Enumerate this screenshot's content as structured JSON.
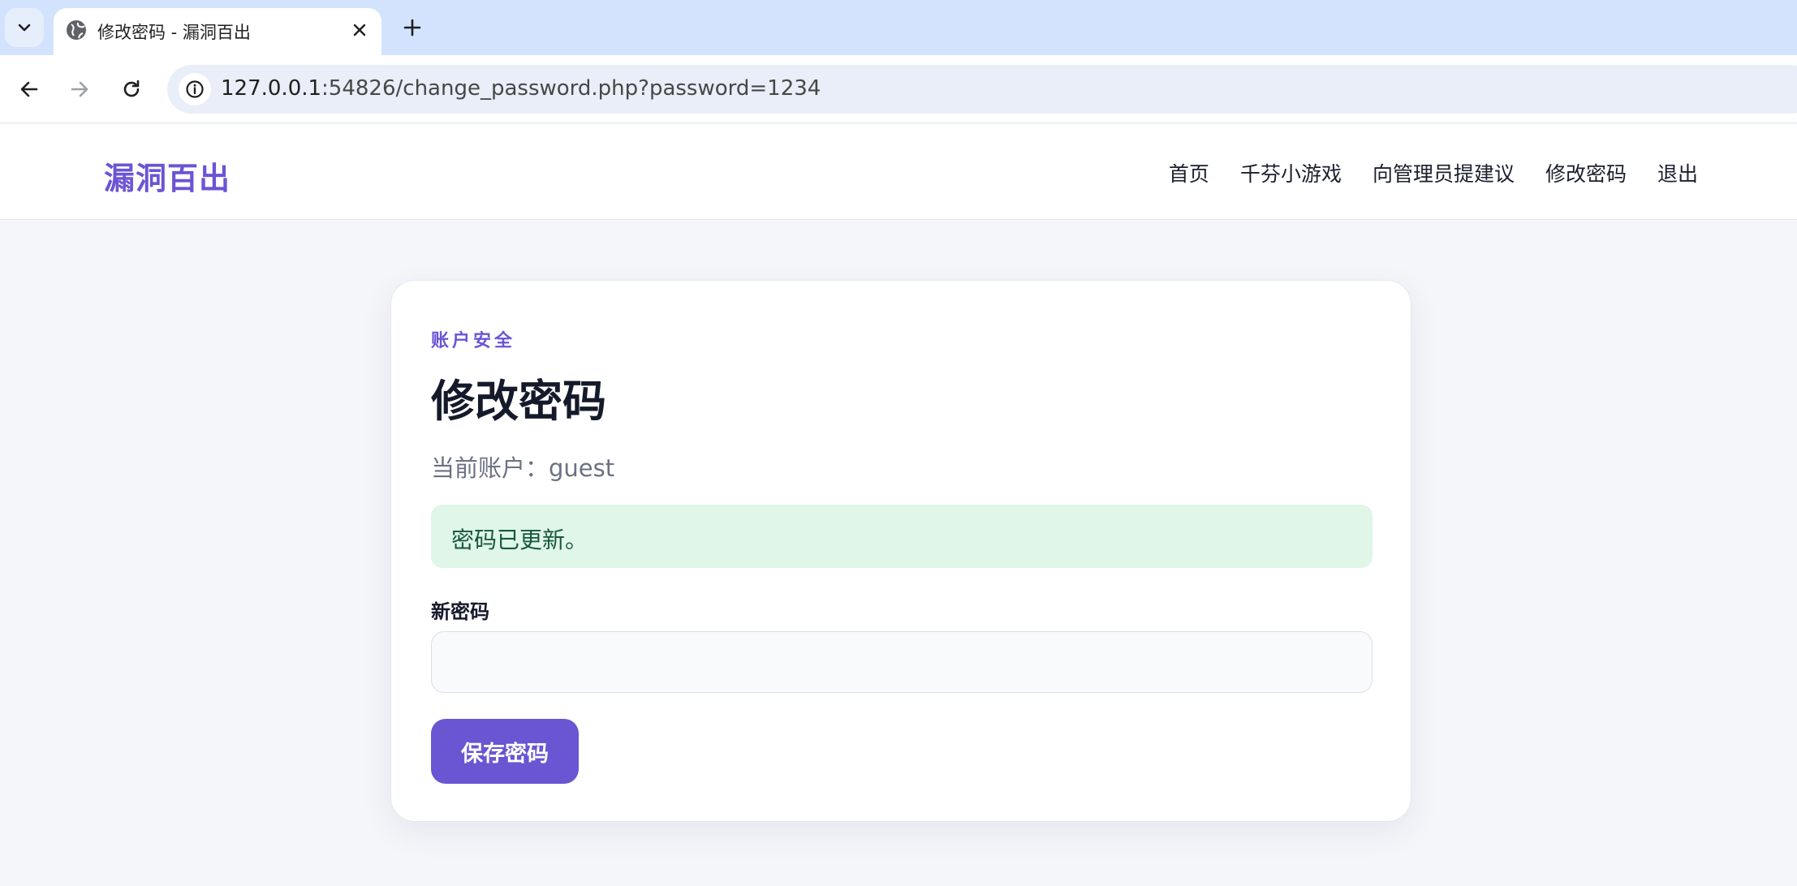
{
  "browser": {
    "tab_title": "修改密码 - 漏洞百出",
    "url_host": "127.0.0.1",
    "url_rest": ":54826/change_password.php?password=1234",
    "icons": {
      "tab_search": "chevron-down-icon",
      "favicon": "globe-icon",
      "close": "close-icon",
      "new_tab": "plus-icon",
      "back": "arrow-left-icon",
      "forward": "arrow-right-icon",
      "reload": "reload-icon",
      "site_info": "info-icon"
    }
  },
  "site": {
    "brand": "漏洞百出",
    "nav": [
      {
        "label": "首页"
      },
      {
        "label": "千芬小游戏"
      },
      {
        "label": "向管理员提建议"
      },
      {
        "label": "修改密码"
      },
      {
        "label": "退出"
      }
    ]
  },
  "card": {
    "eyebrow": "账户安全",
    "title": "修改密码",
    "account_line": "当前账户：guest",
    "alert": "密码已更新。",
    "field_label": "新密码",
    "field_value": "",
    "save_label": "保存密码"
  },
  "colors": {
    "accent": "#6a55d3",
    "success_bg": "#dff6e8",
    "success_text": "#17583a"
  }
}
